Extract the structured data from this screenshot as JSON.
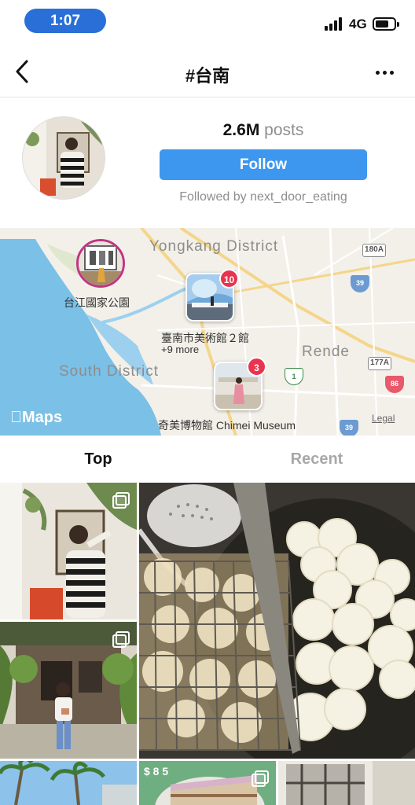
{
  "status": {
    "time": "1:07",
    "network": "4G"
  },
  "header": {
    "title": "#台南",
    "back_icon": "chevron-left-icon",
    "more_icon": "more-horizontal-icon"
  },
  "profile": {
    "posts_count": "2.6M",
    "posts_label": "posts",
    "follow_label": "Follow",
    "followed_by": "Followed by next_door_eating"
  },
  "map": {
    "districts": {
      "yongkang": "Yongkang District",
      "south": "South District",
      "rende": "Rende"
    },
    "places": {
      "park": "台江國家公園",
      "art_museum": "臺南市美術館２館",
      "art_museum_more": "+9 more",
      "chimei": "奇美博物館 Chimei Museum"
    },
    "badges": {
      "art_museum": "10",
      "chimei": "3"
    },
    "road_signs": [
      "180A",
      "177A"
    ],
    "highway_shields": [
      "39",
      "1",
      "86",
      "39"
    ],
    "logo": "Maps",
    "legal": "Legal"
  },
  "tabs": {
    "top": "Top",
    "recent": "Recent"
  },
  "grid": {
    "multi_icon": "multiple-photos-icon",
    "price_tag": "$ 8 5"
  }
}
